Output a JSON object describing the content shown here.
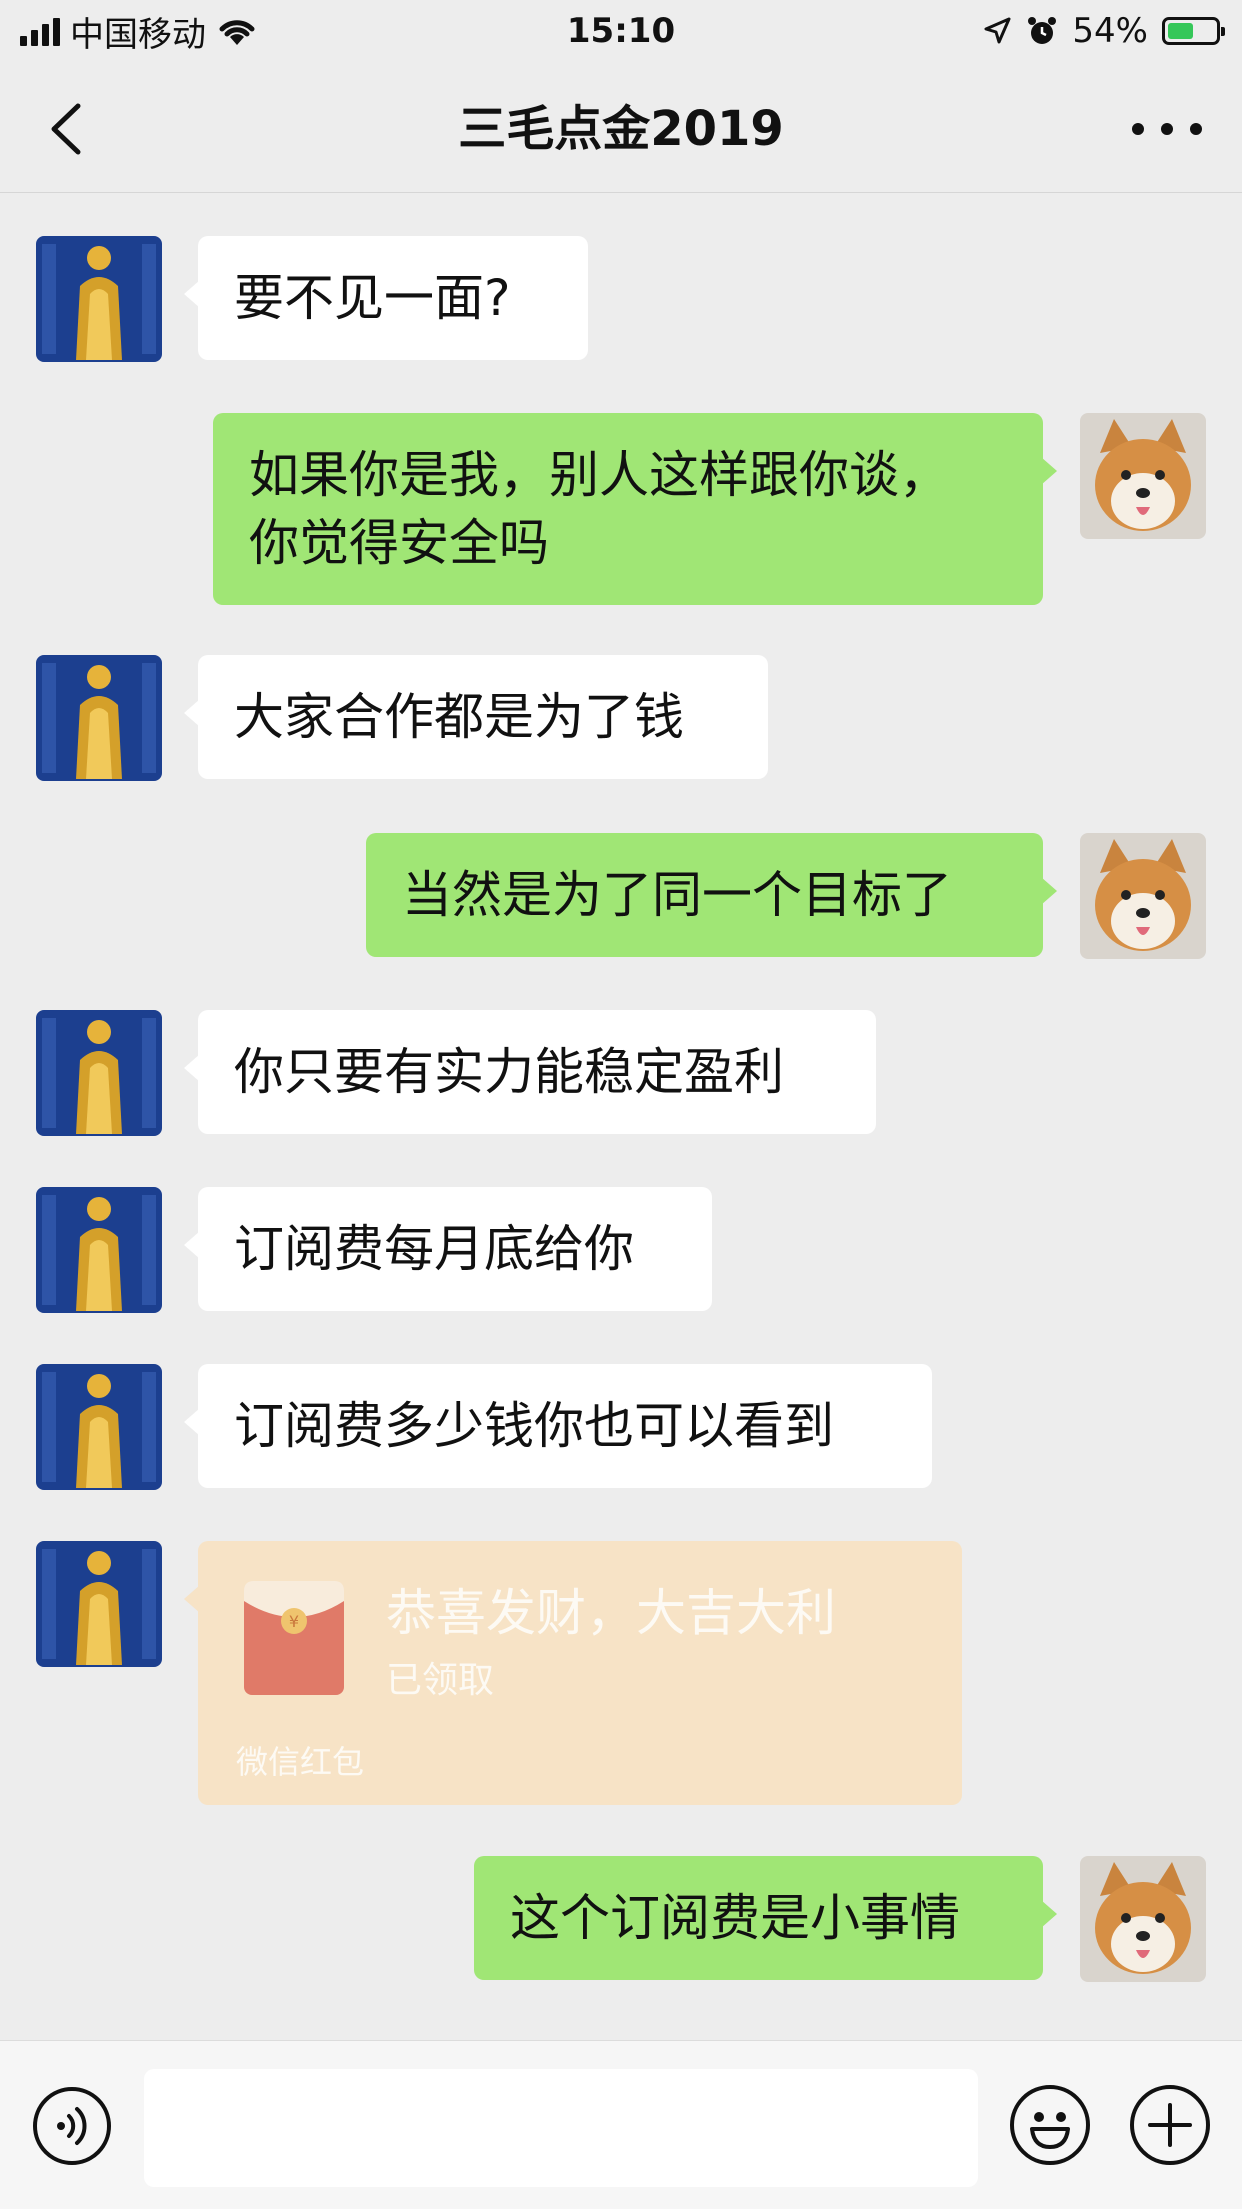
{
  "status_bar": {
    "carrier": "中国移动",
    "time": "15:10",
    "battery": "54%",
    "battery_level": 0.54,
    "icons": [
      "signal-icon",
      "wifi-icon",
      "location-icon",
      "alarm-icon",
      "battery-icon"
    ]
  },
  "nav": {
    "title": "三毛点金2019",
    "back_icon": "chevron-left-icon",
    "more_icon": "more-dots-icon"
  },
  "messages": [
    {
      "side": "left",
      "text": "要不见一面?"
    },
    {
      "side": "right",
      "lines": [
        "如果你是我，别人这样跟你谈，",
        "你觉得安全吗"
      ]
    },
    {
      "side": "left",
      "text": "大家合作都是为了钱"
    },
    {
      "side": "right",
      "text": "当然是为了同一个目标了"
    },
    {
      "side": "left",
      "text": "你只要有实力能稳定盈利"
    },
    {
      "side": "left",
      "text": "订阅费每月底给你"
    },
    {
      "side": "left",
      "text": "订阅费多少钱你也可以看到"
    },
    {
      "side": "left",
      "type": "red_packet",
      "title": "恭喜发财，大吉大利",
      "status": "已领取",
      "footer": "微信红包"
    },
    {
      "side": "right",
      "text": "这个订阅费是小事情"
    }
  ],
  "input_bar": {
    "icons": [
      "voice-icon",
      "emoji-icon",
      "plus-icon"
    ],
    "value": ""
  },
  "colors": {
    "background": "#ededed",
    "green_bubble": "#a0e675",
    "white_bubble": "#ffffff",
    "red_packet_bg": "#f7e3c6",
    "red_packet_icon": "#e07a68"
  }
}
